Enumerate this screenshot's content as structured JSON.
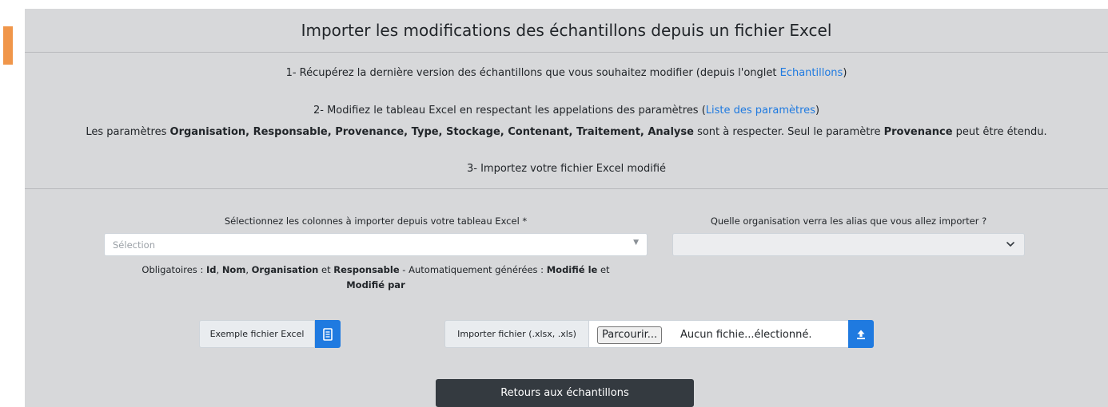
{
  "title": "Importer les modifications des échantillons depuis un fichier Excel",
  "steps": {
    "step1_text": "1- Récupérez la dernière version des échantillons que vous souhaitez modifier (depuis l'onglet ",
    "step1_link": "Echantillons",
    "step1_end": ")",
    "step2_text": "2- Modifiez le tableau Excel en respectant les appelations des paramètres (",
    "step2_link": "Liste des paramètres",
    "step2_end": ")",
    "rule_prefix": "Les paramètres ",
    "rule_params": "Organisation, Responsable, Provenance, Type, Stockage, Contenant, Traitement, Analyse",
    "rule_middle": " sont à respecter. Seul le paramètre ",
    "rule_param2": "Provenance",
    "rule_suffix": " peut être étendu.",
    "step3_text": "3- Importez votre fichier Excel modifié"
  },
  "columns_field": {
    "label": "Sélectionnez les colonnes à importer depuis votre tableau Excel *",
    "placeholder": "Sélection"
  },
  "organisation_field": {
    "label": "Quelle organisation verra les alias que vous allez importer ?",
    "value": ""
  },
  "required_note": {
    "prefix": "Obligatoires : ",
    "f1": "Id",
    "sep1": ", ",
    "f2": "Nom",
    "sep2": ", ",
    "f3": "Organisation",
    "sep3": " et ",
    "f4": "Responsable",
    "middle": " - Automatiquement générées : ",
    "g1": "Modifié le",
    "sep4": " et ",
    "g2": "Modifié par"
  },
  "example": {
    "label": "Exemple fichier Excel",
    "icon": "document-icon"
  },
  "import": {
    "label": "Importer fichier (.xlsx, .xls)",
    "browse_label": "Parcourir...",
    "file_name": "Aucun fichie...électionné.",
    "icon": "upload-icon"
  },
  "back_button": "Retours aux échantillons",
  "colors": {
    "accent": "#f0964a",
    "primary": "#1f7ae0",
    "panel": "#d7d8da",
    "dark_button": "#343a40"
  }
}
